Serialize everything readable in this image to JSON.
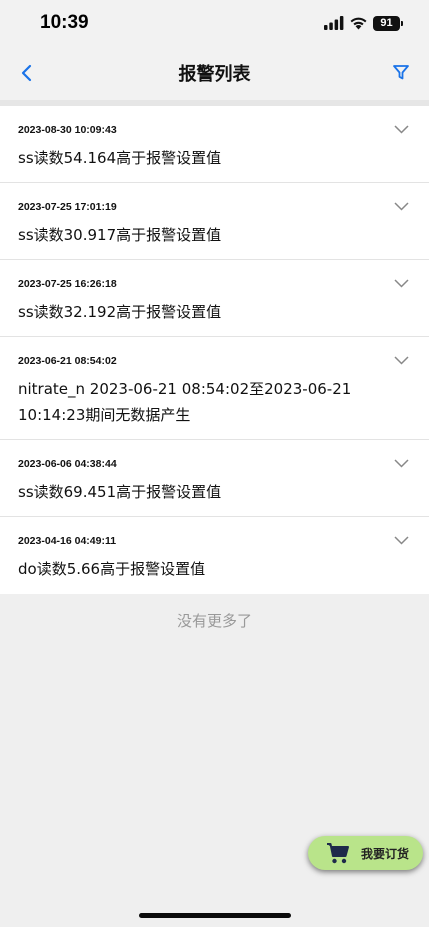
{
  "status_bar": {
    "time": "10:39",
    "battery": "91",
    "icons": [
      "signal-icon",
      "wifi-icon",
      "battery-icon"
    ]
  },
  "header": {
    "title": "报警列表",
    "back_icon": "chevron-left-icon",
    "filter_icon": "filter-icon",
    "accent_color": "#1a73e8"
  },
  "alarms": [
    {
      "time": "2023-08-30 10:09:43",
      "message": "ss读数54.164高于报警设置值"
    },
    {
      "time": "2023-07-25 17:01:19",
      "message": "ss读数30.917高于报警设置值"
    },
    {
      "time": "2023-07-25 16:26:18",
      "message": "ss读数32.192高于报警设置值"
    },
    {
      "time": "2023-06-21 08:54:02",
      "message": "nitrate_n 2023-06-21 08:54:02至2023-06-21 10:14:23期间无数据产生"
    },
    {
      "time": "2023-06-06 04:38:44",
      "message": "ss读数69.451高于报警设置值"
    },
    {
      "time": "2023-04-16 04:49:11",
      "message": "do读数5.66高于报警设置值"
    }
  ],
  "list_footer": "没有更多了",
  "order_button": {
    "label": "我要订货",
    "icon": "shopping-cart-icon",
    "color": "#b9e48a"
  }
}
